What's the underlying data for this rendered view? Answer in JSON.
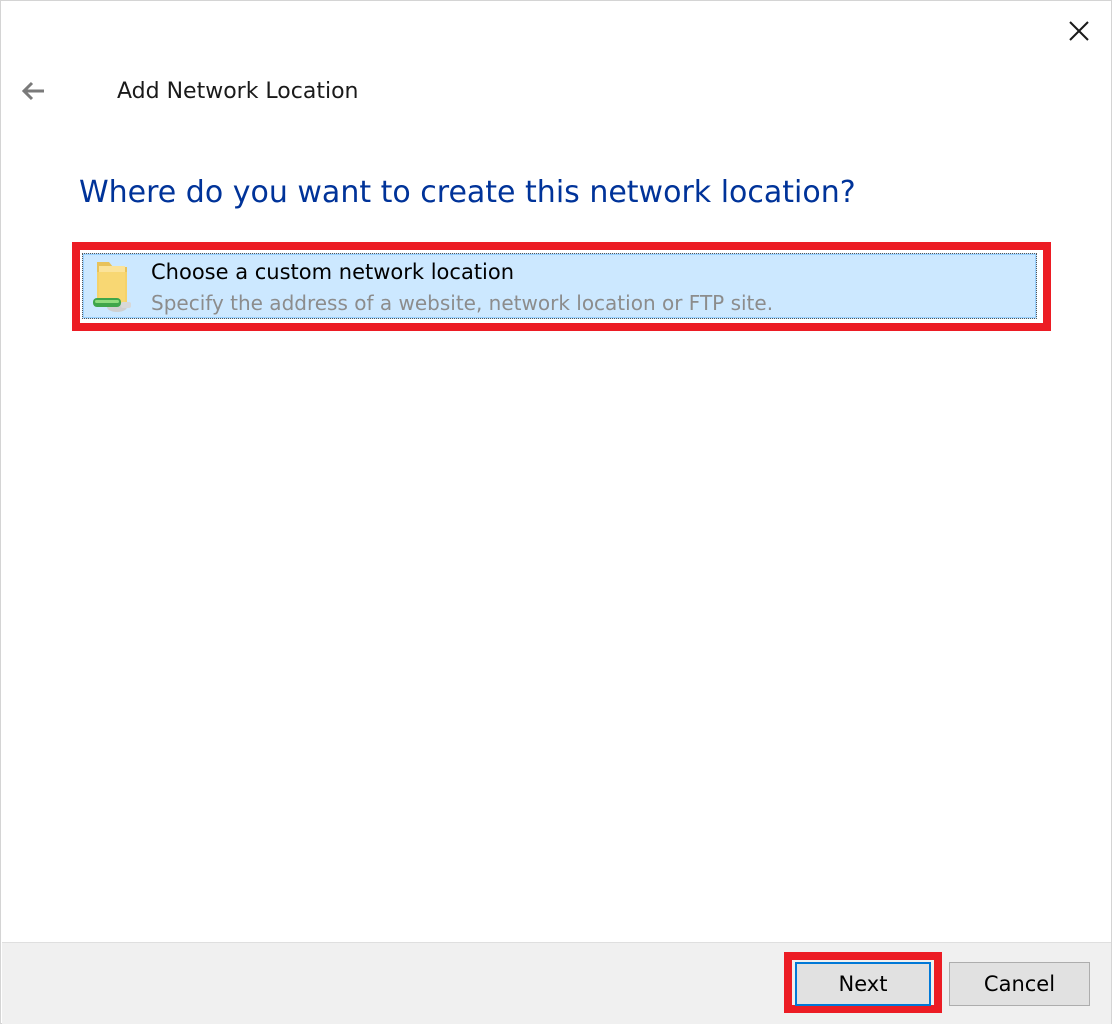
{
  "window": {
    "title": "Add Network Location"
  },
  "titlebar": {
    "close_icon": "close-icon",
    "back_icon": "back-arrow-icon"
  },
  "main": {
    "heading": "Where do you want to create this network location?",
    "options": [
      {
        "title": "Choose a custom network location",
        "description": "Specify the address of a website, network location or FTP site.",
        "icon": "network-folder-icon",
        "selected": true
      }
    ]
  },
  "footer": {
    "next_label": "Next",
    "cancel_label": "Cancel"
  },
  "colors": {
    "heading": "#003399",
    "selection_background": "#cce8ff",
    "annotation_highlight": "#ec1c24",
    "footer_background": "#f0f0f0"
  }
}
